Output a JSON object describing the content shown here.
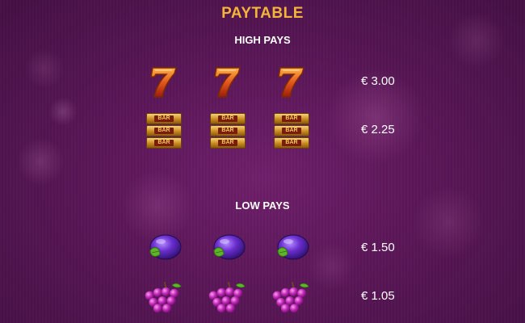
{
  "title": "PAYTABLE",
  "high_pays": {
    "heading": "HIGH PAYS",
    "rows": [
      {
        "symbol": "seven-icon",
        "price": "€ 3.00"
      },
      {
        "symbol": "bar-icon",
        "price": "€ 2.25"
      }
    ]
  },
  "low_pays": {
    "heading": "LOW PAYS",
    "rows": [
      {
        "symbol": "plum-icon",
        "price": "€ 1.50"
      },
      {
        "symbol": "grapes-icon",
        "price": "€ 1.05"
      }
    ]
  },
  "bar_label": "BAR",
  "colors": {
    "background": "#5a1657",
    "title": "#f4b43a",
    "text": "#ffffff"
  }
}
